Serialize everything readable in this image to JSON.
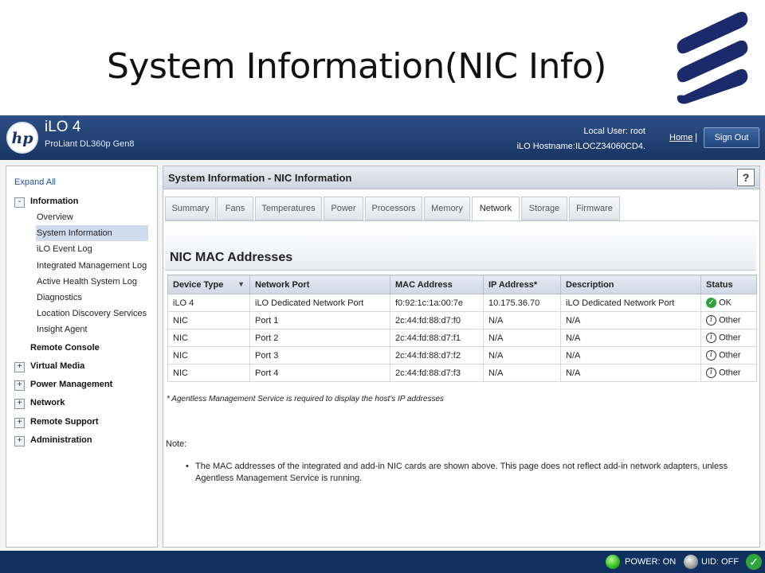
{
  "slide": {
    "title": "System Information(NIC Info)"
  },
  "brand": {
    "accent": "#1b2a6b",
    "header_bg": "#173564",
    "statusbar_bg": "#103060"
  },
  "header": {
    "product": "iLO 4",
    "model": "ProLiant DL360p Gen8",
    "local_user": "Local User:  root",
    "hostname": "iLO Hostname:ILOCZ34060CD4.",
    "home": "Home",
    "separator": "|",
    "sign_out": "Sign Out"
  },
  "sidebar": {
    "expand_all": "Expand All",
    "information": {
      "toggle": "-",
      "label": "Information",
      "items": [
        "Overview",
        "System Information",
        "iLO Event Log",
        "Integrated Management Log",
        "Active Health System Log",
        "Diagnostics",
        "Location Discovery Services",
        "Insight Agent"
      ]
    },
    "remote_console": "Remote Console",
    "groups": [
      {
        "toggle": "+",
        "label": "Virtual Media"
      },
      {
        "toggle": "+",
        "label": "Power Management"
      },
      {
        "toggle": "+",
        "label": "Network"
      },
      {
        "toggle": "+",
        "label": "Remote Support"
      },
      {
        "toggle": "+",
        "label": "Administration"
      }
    ]
  },
  "content": {
    "title": "System Information - NIC Information",
    "help": "?",
    "tabs": [
      "Summary",
      "Fans",
      "Temperatures",
      "Power",
      "Processors",
      "Memory",
      "Network",
      "Storage",
      "Firmware"
    ],
    "active_tab": "Network",
    "section_title": "NIC MAC Addresses",
    "table": {
      "headers": [
        "Device Type",
        "Network Port",
        "MAC Address",
        "IP Address*",
        "Description",
        "Status"
      ],
      "rows": [
        [
          "iLO 4",
          "iLO Dedicated Network Port",
          "f0:92:1c:1a:00:7e",
          "10.175.36.70",
          "iLO Dedicated Network Port",
          "OK"
        ],
        [
          "NIC",
          "Port 1",
          "2c:44:fd:88:d7:f0",
          "N/A",
          "N/A",
          "Other"
        ],
        [
          "NIC",
          "Port 2",
          "2c:44:fd:88:d7:f1",
          "N/A",
          "N/A",
          "Other"
        ],
        [
          "NIC",
          "Port 3",
          "2c:44:fd:88:d7:f2",
          "N/A",
          "N/A",
          "Other"
        ],
        [
          "NIC",
          "Port 4",
          "2c:44:fd:88:d7:f3",
          "N/A",
          "N/A",
          "Other"
        ]
      ]
    },
    "agentless_note": "* Agentless Management Service is required to display the host's IP addresses",
    "note_label": "Note:",
    "note_bullet": "The MAC addresses of the integrated and add-in NIC cards are shown above. This page does not reflect add-in network adapters, unless Agentless Management Service is running."
  },
  "statusbar": {
    "power": "POWER: ON",
    "uid": "UID: OFF"
  }
}
